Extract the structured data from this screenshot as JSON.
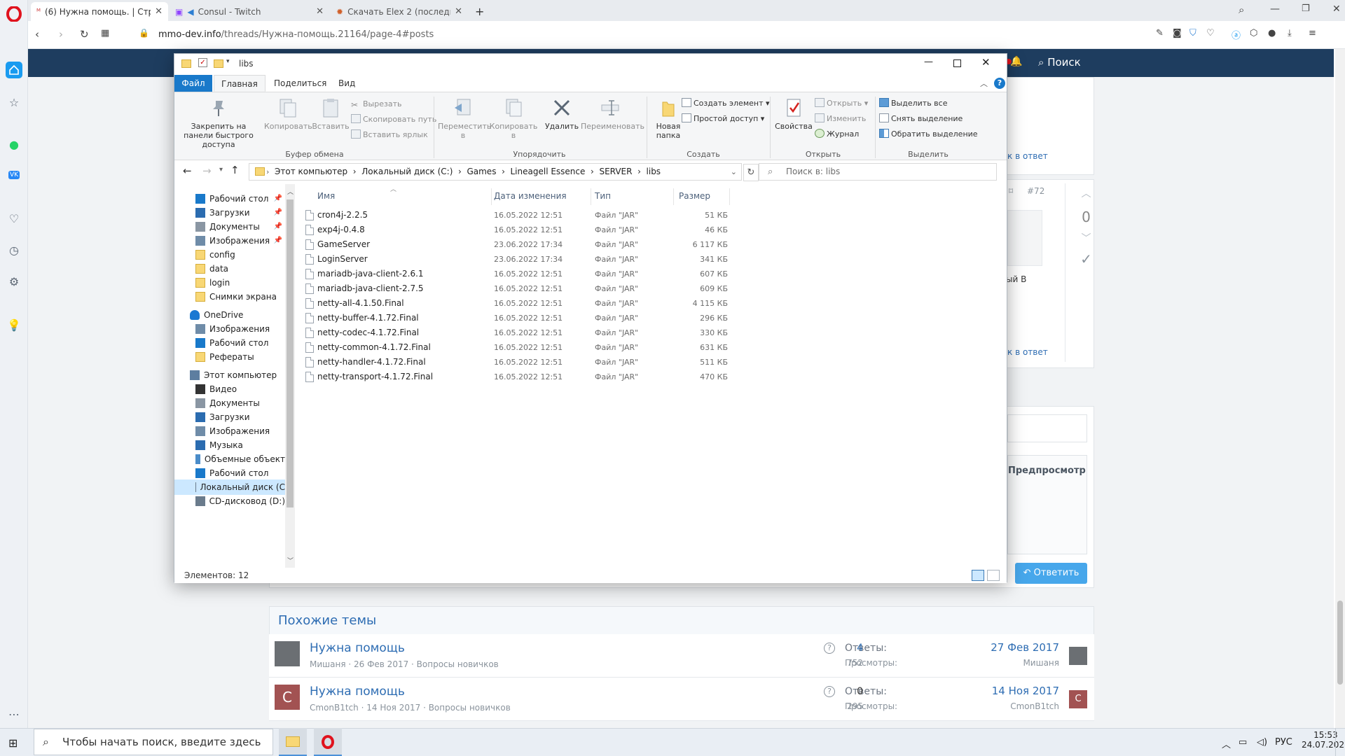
{
  "browser": {
    "tabs": [
      {
        "label": "(6) Нужна помощь. | Стра"
      },
      {
        "label": "Consul - Twitch"
      },
      {
        "label": "Скачать Elex 2 (последня"
      }
    ],
    "url_host": "mmo-dev.info",
    "url_path": "/threads/Нужна-помощь.21164/page-4#posts"
  },
  "site": {
    "search_label": "Поиск",
    "side_texts": {
      "reply1": "к в ответ",
      "reply2": "к в ответ",
      "post_num": "#72",
      "vote_count": "0",
      "partial": "ый В",
      "preview": "Предпросмотр"
    },
    "reply_button": "Ответить",
    "similar": {
      "heading": "Похожие темы",
      "rows": [
        {
          "title": "Нужна помощь",
          "meta": "Мишаня · 26 Фев 2017 · Вопросы новичков",
          "replies_label": "Ответы:",
          "replies": "4",
          "views_label": "Просмотры:",
          "views": "752",
          "date": "27 Фев 2017",
          "user": "Мишаня"
        },
        {
          "title": "Нужна помощь",
          "meta": "CmonB1tch · 14 Ноя 2017 · Вопросы новичков",
          "replies_label": "Ответы:",
          "replies": "0",
          "views_label": "Просмотры:",
          "views": "295",
          "date": "14 Ноя 2017",
          "user": "CmonB1tch",
          "avatar_letter": "C"
        }
      ]
    }
  },
  "explorer": {
    "title": "libs",
    "ribbon_tabs": [
      "Файл",
      "Главная",
      "Поделиться",
      "Вид"
    ],
    "ribbon": {
      "pin": "Закрепить на панели быстрого доступа",
      "copy": "Копировать",
      "paste": "Вставить",
      "cut": "Вырезать",
      "copy_path": "Скопировать путь",
      "paste_shortcut": "Вставить ярлык",
      "group_clipboard": "Буфер обмена",
      "move_to": "Переместить в",
      "copy_to": "Копировать в",
      "delete": "Удалить",
      "rename": "Переименовать",
      "group_organize": "Упорядочить",
      "new_folder": "Новая папка",
      "new_item": "Создать элемент",
      "easy_access": "Простой доступ",
      "group_new": "Создать",
      "properties": "Свойства",
      "open": "Открыть",
      "edit": "Изменить",
      "history": "Журнал",
      "group_open": "Открыть",
      "select_all": "Выделить все",
      "select_none": "Снять выделение",
      "invert": "Обратить выделение",
      "group_select": "Выделить"
    },
    "breadcrumb": "Этот компьютер  ›  Локальный диск (C:)  ›  Games  ›  Lineagell Essence  ›  SERVER  ›  libs",
    "search_placeholder": "Поиск в: libs",
    "nav": [
      {
        "label": "Рабочий стол",
        "pinned": true
      },
      {
        "label": "Загрузки",
        "pinned": true
      },
      {
        "label": "Документы",
        "pinned": true
      },
      {
        "label": "Изображения",
        "pinned": true
      },
      {
        "label": "config"
      },
      {
        "label": "data"
      },
      {
        "label": "login"
      },
      {
        "label": "Снимки экрана"
      },
      {
        "label": "OneDrive"
      },
      {
        "label": "Изображения"
      },
      {
        "label": "Рабочий стол"
      },
      {
        "label": "Рефераты"
      },
      {
        "label": "Этот компьютер"
      },
      {
        "label": "Видео"
      },
      {
        "label": "Документы"
      },
      {
        "label": "Загрузки"
      },
      {
        "label": "Изображения"
      },
      {
        "label": "Музыка"
      },
      {
        "label": "Объемные объект"
      },
      {
        "label": "Рабочий стол"
      },
      {
        "label": "Локальный диск (С"
      },
      {
        "label": "CD-дисковод (D:)"
      }
    ],
    "columns": {
      "name": "Имя",
      "date": "Дата изменения",
      "type": "Тип",
      "size": "Размер"
    },
    "files": [
      {
        "name": "cron4j-2.2.5",
        "date": "16.05.2022 12:51",
        "type": "Файл \"JAR\"",
        "size": "51 КБ"
      },
      {
        "name": "exp4j-0.4.8",
        "date": "16.05.2022 12:51",
        "type": "Файл \"JAR\"",
        "size": "46 КБ"
      },
      {
        "name": "GameServer",
        "date": "23.06.2022 17:34",
        "type": "Файл \"JAR\"",
        "size": "6 117 КБ"
      },
      {
        "name": "LoginServer",
        "date": "23.06.2022 17:34",
        "type": "Файл \"JAR\"",
        "size": "341 КБ"
      },
      {
        "name": "mariadb-java-client-2.6.1",
        "date": "16.05.2022 12:51",
        "type": "Файл \"JAR\"",
        "size": "607 КБ"
      },
      {
        "name": "mariadb-java-client-2.7.5",
        "date": "16.05.2022 12:51",
        "type": "Файл \"JAR\"",
        "size": "609 КБ"
      },
      {
        "name": "netty-all-4.1.50.Final",
        "date": "16.05.2022 12:51",
        "type": "Файл \"JAR\"",
        "size": "4 115 КБ"
      },
      {
        "name": "netty-buffer-4.1.72.Final",
        "date": "16.05.2022 12:51",
        "type": "Файл \"JAR\"",
        "size": "296 КБ"
      },
      {
        "name": "netty-codec-4.1.72.Final",
        "date": "16.05.2022 12:51",
        "type": "Файл \"JAR\"",
        "size": "330 КБ"
      },
      {
        "name": "netty-common-4.1.72.Final",
        "date": "16.05.2022 12:51",
        "type": "Файл \"JAR\"",
        "size": "631 КБ"
      },
      {
        "name": "netty-handler-4.1.72.Final",
        "date": "16.05.2022 12:51",
        "type": "Файл \"JAR\"",
        "size": "511 КБ"
      },
      {
        "name": "netty-transport-4.1.72.Final",
        "date": "16.05.2022 12:51",
        "type": "Файл \"JAR\"",
        "size": "470 КБ"
      }
    ],
    "status": "Элементов: 12"
  },
  "taskbar": {
    "search_placeholder": "Чтобы начать поиск, введите здесь запрос",
    "lang": "РУС",
    "time": "15:53",
    "date": "24.07.2022"
  },
  "colors": {
    "accent": "#1979ca",
    "site_header": "#1e3d5f",
    "link": "#2e6db3",
    "opera_red": "#e0121d"
  }
}
